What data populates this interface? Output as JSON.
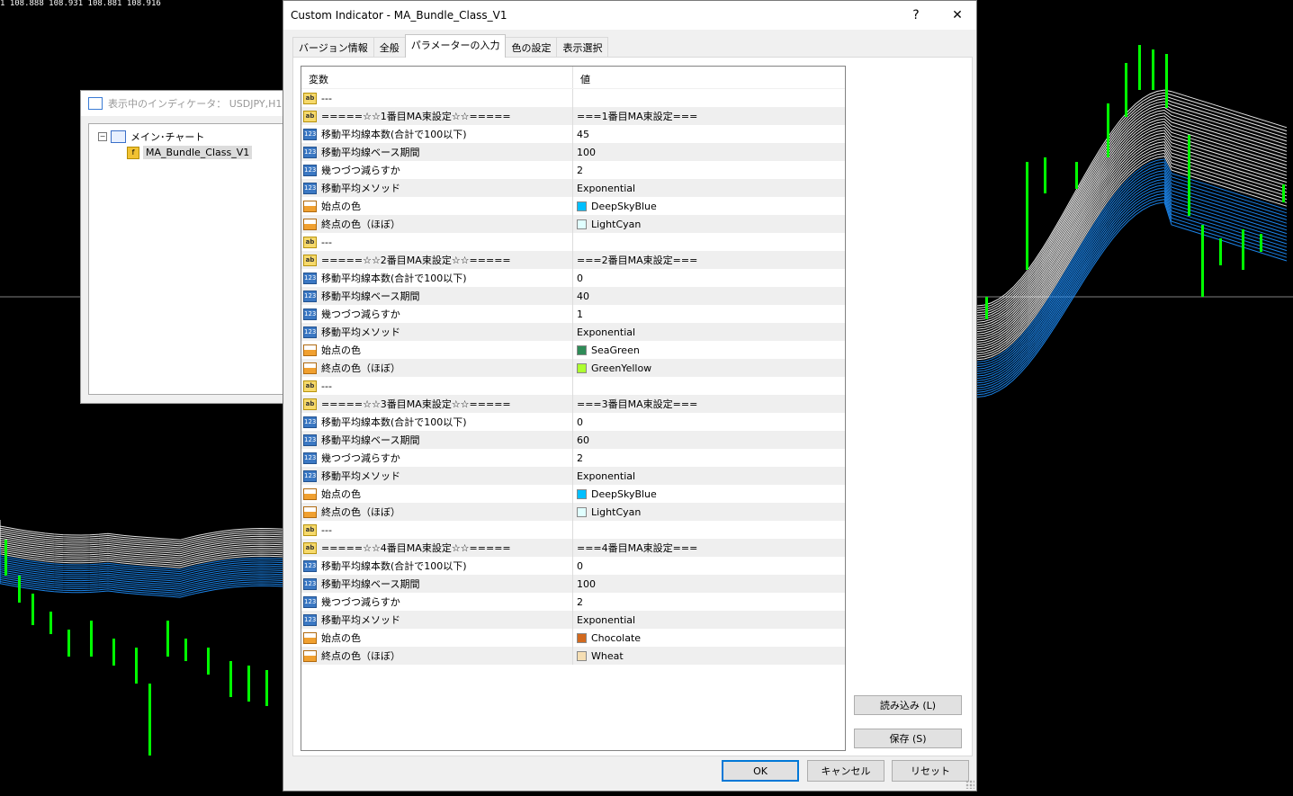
{
  "chart": {
    "quote_text": "1  108.888 108.931 108.881 108.916",
    "colors": {
      "candle": "#00ff00",
      "ribbon_light": "#e0ffff",
      "ribbon_blue": "#1e90ff",
      "grid": "#808080"
    }
  },
  "indicator_window": {
    "title": "表示中のインディケータ： USDJPY,H1",
    "tree_root": "メイン･チャート",
    "tree_child": "MA_Bundle_Class_V1",
    "collapse_glyph": "−"
  },
  "dialog": {
    "title": "Custom Indicator - MA_Bundle_Class_V1",
    "help": "?",
    "close": "✕",
    "tabs": [
      {
        "label": "バージョン情報"
      },
      {
        "label": "全般"
      },
      {
        "label": "パラメーターの入力"
      },
      {
        "label": "色の設定"
      },
      {
        "label": "表示選択"
      }
    ],
    "active_tab": "パラメーターの入力",
    "grid": {
      "header_variable": "変数",
      "header_value": "値",
      "rows": [
        {
          "icon": "ab",
          "name": "---",
          "value": "",
          "swatch": ""
        },
        {
          "icon": "ab",
          "name": "=====☆☆1番目MA束設定☆☆=====",
          "value": "===1番目MA束設定===",
          "swatch": ""
        },
        {
          "icon": "num",
          "name": "移動平均線本数(合計で100以下)",
          "value": "45",
          "swatch": ""
        },
        {
          "icon": "num",
          "name": "移動平均線ベース期間",
          "value": "100",
          "swatch": ""
        },
        {
          "icon": "num",
          "name": "幾つづつ減らすか",
          "value": "2",
          "swatch": ""
        },
        {
          "icon": "num",
          "name": "移動平均メソッド",
          "value": "Exponential",
          "swatch": ""
        },
        {
          "icon": "clr",
          "name": "始点の色",
          "value": "DeepSkyBlue",
          "swatch": "#00bfff"
        },
        {
          "icon": "clr",
          "name": "終点の色（ほぼ）",
          "value": "LightCyan",
          "swatch": "#e0ffff"
        },
        {
          "icon": "ab",
          "name": "---",
          "value": "",
          "swatch": ""
        },
        {
          "icon": "ab",
          "name": "=====☆☆2番目MA束設定☆☆=====",
          "value": "===2番目MA束設定===",
          "swatch": ""
        },
        {
          "icon": "num",
          "name": "移動平均線本数(合計で100以下)",
          "value": "0",
          "swatch": ""
        },
        {
          "icon": "num",
          "name": "移動平均線ベース期間",
          "value": "40",
          "swatch": ""
        },
        {
          "icon": "num",
          "name": "幾つづつ減らすか",
          "value": "1",
          "swatch": ""
        },
        {
          "icon": "num",
          "name": "移動平均メソッド",
          "value": "Exponential",
          "swatch": ""
        },
        {
          "icon": "clr",
          "name": "始点の色",
          "value": "SeaGreen",
          "swatch": "#2e8b57"
        },
        {
          "icon": "clr",
          "name": "終点の色（ほぼ）",
          "value": "GreenYellow",
          "swatch": "#adff2f"
        },
        {
          "icon": "ab",
          "name": "---",
          "value": "",
          "swatch": ""
        },
        {
          "icon": "ab",
          "name": "=====☆☆3番目MA束設定☆☆=====",
          "value": "===3番目MA束設定===",
          "swatch": ""
        },
        {
          "icon": "num",
          "name": "移動平均線本数(合計で100以下)",
          "value": "0",
          "swatch": ""
        },
        {
          "icon": "num",
          "name": "移動平均線ベース期間",
          "value": "60",
          "swatch": ""
        },
        {
          "icon": "num",
          "name": "幾つづつ減らすか",
          "value": "2",
          "swatch": ""
        },
        {
          "icon": "num",
          "name": "移動平均メソッド",
          "value": "Exponential",
          "swatch": ""
        },
        {
          "icon": "clr",
          "name": "始点の色",
          "value": "DeepSkyBlue",
          "swatch": "#00bfff"
        },
        {
          "icon": "clr",
          "name": "終点の色（ほぼ）",
          "value": "LightCyan",
          "swatch": "#e0ffff"
        },
        {
          "icon": "ab",
          "name": "---",
          "value": "",
          "swatch": ""
        },
        {
          "icon": "ab",
          "name": "=====☆☆4番目MA束設定☆☆=====",
          "value": "===4番目MA束設定===",
          "swatch": ""
        },
        {
          "icon": "num",
          "name": "移動平均線本数(合計で100以下)",
          "value": "0",
          "swatch": ""
        },
        {
          "icon": "num",
          "name": "移動平均線ベース期間",
          "value": "100",
          "swatch": ""
        },
        {
          "icon": "num",
          "name": "幾つづつ減らすか",
          "value": "2",
          "swatch": ""
        },
        {
          "icon": "num",
          "name": "移動平均メソッド",
          "value": "Exponential",
          "swatch": ""
        },
        {
          "icon": "clr",
          "name": "始点の色",
          "value": "Chocolate",
          "swatch": "#d2691e"
        },
        {
          "icon": "clr",
          "name": "終点の色（ほぼ）",
          "value": "Wheat",
          "swatch": "#f5deb3"
        }
      ]
    },
    "buttons": {
      "load": "読み込み (L)",
      "save": "保存 (S)",
      "ok": "OK",
      "cancel": "キャンセル",
      "reset": "リセット"
    }
  }
}
